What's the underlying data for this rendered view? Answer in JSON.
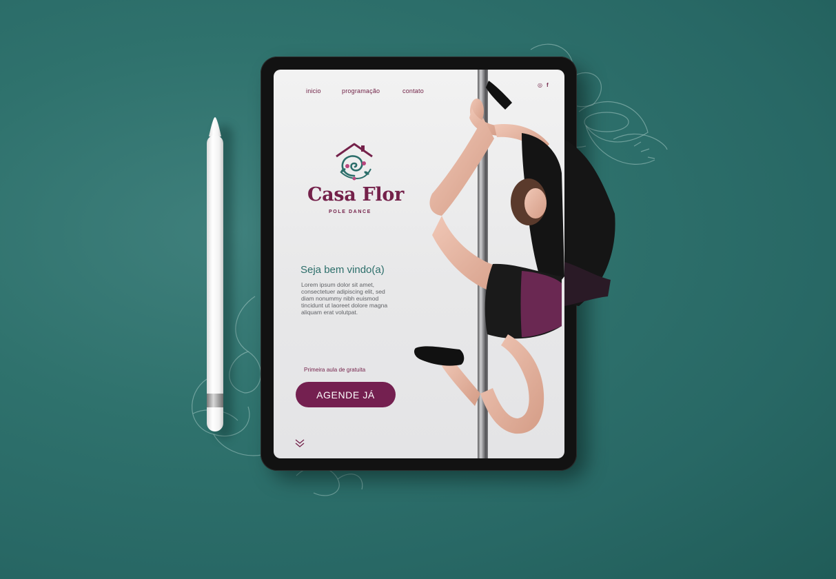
{
  "nav": {
    "links": [
      "inicio",
      "programação",
      "contato"
    ],
    "social_icons": [
      "instagram-icon",
      "facebook-icon"
    ],
    "social_glyphs": [
      "◎",
      "f"
    ]
  },
  "brand": {
    "name": "Casa Flor",
    "subtitle": "POLE DANCE"
  },
  "welcome": {
    "title": "Seja bem vindo(a)",
    "body": "Lorem ipsum dolor sit amet, consectetuer adipiscing elit, sed diam nonummy nibh euismod tincidunt ut laoreet dolore magna aliquam erat volutpat."
  },
  "cta": {
    "note": "Primeira aula de gratuita",
    "button_label": "AGENDE JÁ"
  },
  "colors": {
    "background": "#2f726d",
    "brand": "#74214a",
    "accent": "#2c6e6a",
    "button": "#742050",
    "screen": "#eeeeee"
  }
}
